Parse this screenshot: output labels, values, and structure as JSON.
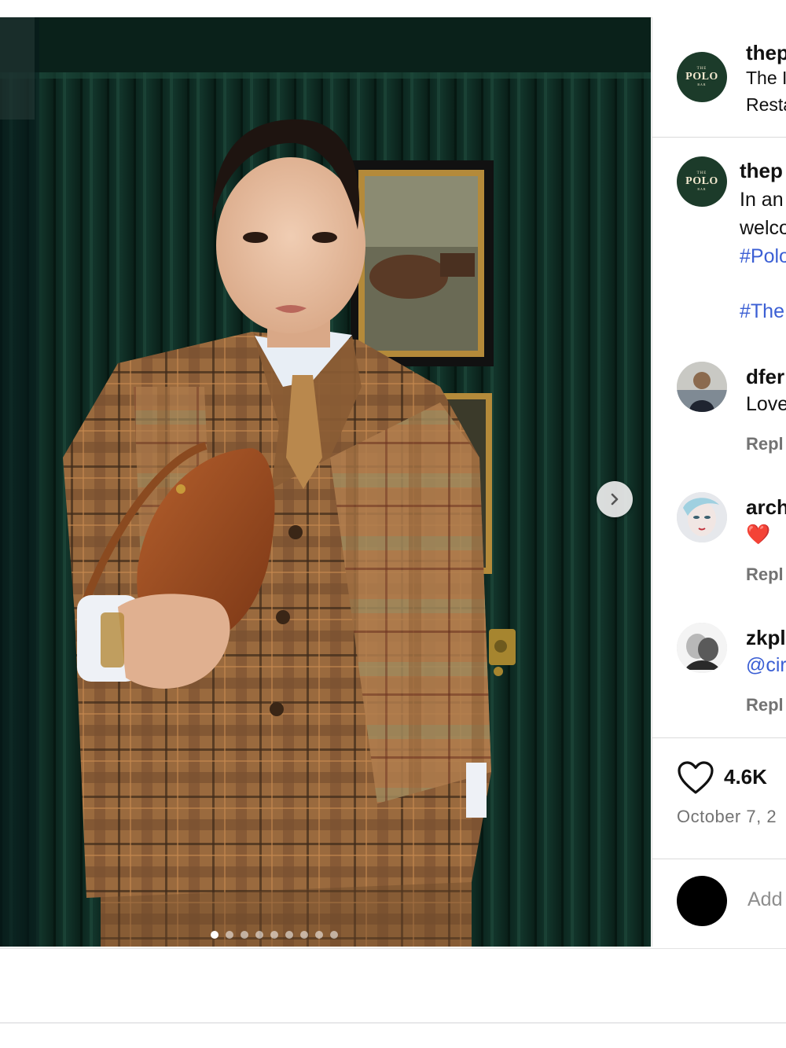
{
  "post": {
    "image": {
      "alt_subject": "woman in plaid patchwork suit holding brown leather bag",
      "carousel_total": 9,
      "carousel_active": 1
    },
    "header": {
      "username": "thep",
      "subtitle_line1": "The I",
      "subtitle_line2": "Resta",
      "logo": {
        "top": "THE",
        "main": "POLO",
        "bottom": "BAR"
      }
    },
    "caption": {
      "username": "thep",
      "line1": "In an",
      "line2": "welco",
      "hashtag1": "#Polo",
      "hashtag2": "#The"
    },
    "comments": [
      {
        "username": "dfer",
        "text": "Love",
        "reply_label": "Repl"
      },
      {
        "username": "arch",
        "text": "❤️",
        "reply_label": "Repl"
      },
      {
        "username": "zkpl",
        "text": "@cir",
        "reply_label": "Repl"
      }
    ],
    "likes": "4.6K",
    "date": "October 7, 2",
    "add_comment_placeholder": "Add"
  },
  "colors": {
    "brand_green": "#1c3b2a",
    "link_blue": "#3b5fd4",
    "muted_gray": "#737373"
  },
  "icons": {
    "next": "chevron-right-icon",
    "like": "heart-outline-icon"
  }
}
